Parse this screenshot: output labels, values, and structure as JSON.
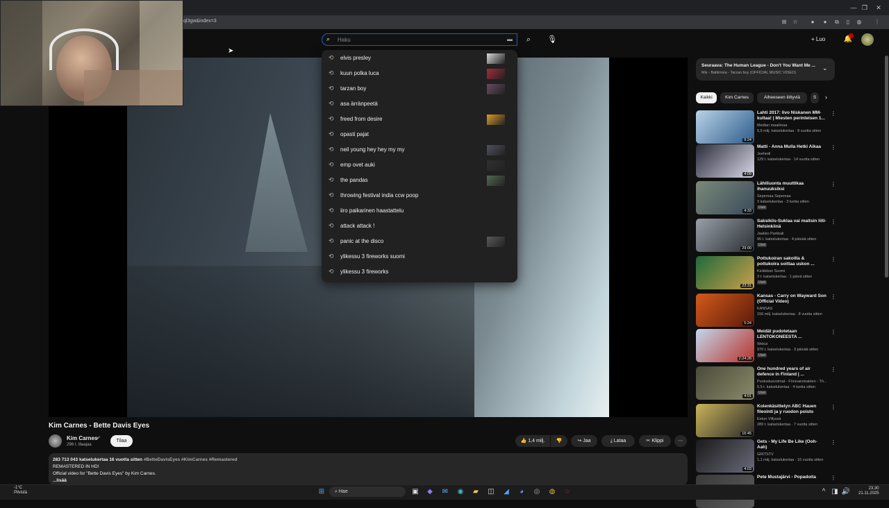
{
  "browser": {
    "url_fragment": "ql3gw&index=3"
  },
  "search": {
    "placeholder": "Haku",
    "suggestions": [
      {
        "text": "elvis presley"
      },
      {
        "text": "kuun polka luca"
      },
      {
        "text": "tarzan boy"
      },
      {
        "text": "asa ärränpeetä"
      },
      {
        "text": "freed from desire"
      },
      {
        "text": "opasti pajat"
      },
      {
        "text": "neil young hey hey my my"
      },
      {
        "text": "emp ovet auki"
      },
      {
        "text": "the pandas"
      },
      {
        "text": "throwing festival india ccw poop"
      },
      {
        "text": "iiro paikarinen haastattelu"
      },
      {
        "text": "attack attack !"
      },
      {
        "text": "panic at the disco"
      },
      {
        "text": "ylikessu 3 fireworks suomi"
      },
      {
        "text": "ylikessu 3 fireworks"
      }
    ]
  },
  "header": {
    "create_label": "Luo"
  },
  "video": {
    "title": "Kim Carnes - Bette Davis Eyes",
    "channel": "Kim Carnes",
    "subscribers": "296 t. tilaajaa",
    "subscribe_label": "Tilaa",
    "likes": "1,4 milj.",
    "share_label": "Jaa",
    "download_label": "Lataa",
    "clip_label": "Klippi",
    "description": {
      "stats": "283 713 043 katselukertaa  16 vuotta sitten",
      "tags": "#BetteDavisEyes #KimCarnes #Remastered",
      "line2": "REMASTERED IN HD!",
      "line3": "Official video for \"Bette Davis Eyes\" by Kim Carnes.",
      "more": "...lisää"
    }
  },
  "sidebar": {
    "upnext_title": "Seuraava: The Human League - Don't You Want Me ...",
    "upnext_sub": "Mix - Baltimora - Tarzan boy (OFFICIAL MUSIC VIDEO)",
    "chips": [
      "Kaikki",
      "Kim Carnes",
      "Aiheeseen liittyviä",
      "S"
    ],
    "recommendations": [
      {
        "title": "Lahti 2017: Iivo Niskanen MM-kultaa! | Miesten perinteisen 1...",
        "channel": "Median maailmaa",
        "meta": "5,6 milj. katselukertaa · 8 vuotta sitten",
        "duration": "9:24",
        "badge": ""
      },
      {
        "title": "Matti - Anna Mulla Hetki Aikaa",
        "channel": "Jeehedi",
        "meta": "129 t. katselukertaa · 14 vuotta sitten",
        "duration": "4:09",
        "badge": ""
      },
      {
        "title": "Lähiliuonta muuttikaa ihanuuksiksi",
        "channel": "Sepemaa Sepemaa",
        "meta": "3 katselukertaa · 3 tuntia sitten",
        "duration": "4:33",
        "badge": "Uusi"
      },
      {
        "title": "Saksikiis-Suklaa vai maitsin liiti-Helsinkiinä",
        "channel": "Jaakko Parkkali",
        "meta": "95 t. katselukertaa · 4 päivää sitten",
        "duration": "29:00",
        "badge": "Uusi"
      },
      {
        "title": "Pottukoiran sakoilla & pottukoira soittaa uskon ...",
        "channel": "Kickkikon Suomi",
        "meta": "3 t. katselukertaa · 1 päivä sitten",
        "duration": "23:31",
        "badge": "Uusi"
      },
      {
        "title": "Kansas - Carry on Wayward Son (Official Video)",
        "channel": "KANSAS",
        "meta": "156 milj. katselukertaa · 8 vuotta sitten",
        "duration": "5:24",
        "badge": ""
      },
      {
        "title": "Meidät pudotetaan LENTOKONEESTA ...",
        "channel": "Wekui",
        "meta": "970 t. katselukertaa · 3 päivää sitten",
        "duration": "2:24:28",
        "badge": "Uusi"
      },
      {
        "title": "One hundred years of air defence in Finland | ...",
        "channel": "Puolustusvoimat - Försvarsmakten - Th...",
        "meta": "5,5 t. katselukertaa · 4 tuntia sitten",
        "duration": "4:01",
        "badge": "Uusi"
      },
      {
        "title": "Kolenkäsittelyn ABC Hauen fileointi ja y ruodon poisto",
        "channel": "Eetun Villyssä",
        "meta": "289 t. katselukertaa · 7 vuotta sitten",
        "duration": "16:45",
        "badge": ""
      },
      {
        "title": "Gets - My Life Be Like (Ooh-Aah)",
        "channel": "GRITSTV",
        "meta": "1,1 milj. katselukertaa · 16 vuotta sitten",
        "duration": "4:03",
        "badge": ""
      },
      {
        "title": "Pete Mustajärvi - Popadoita",
        "channel": "",
        "meta": "",
        "duration": "",
        "badge": ""
      }
    ]
  },
  "taskbar": {
    "weather_temp": "-1°C",
    "weather_desc": "Pilvistä",
    "search_label": "Hae",
    "time": "23.30",
    "date": "21.11.2025"
  },
  "colors": {
    "accent_blue": "#1c62b9",
    "background": "#0f0f0f",
    "surface": "#272727",
    "badge_red": "#cc0000"
  }
}
